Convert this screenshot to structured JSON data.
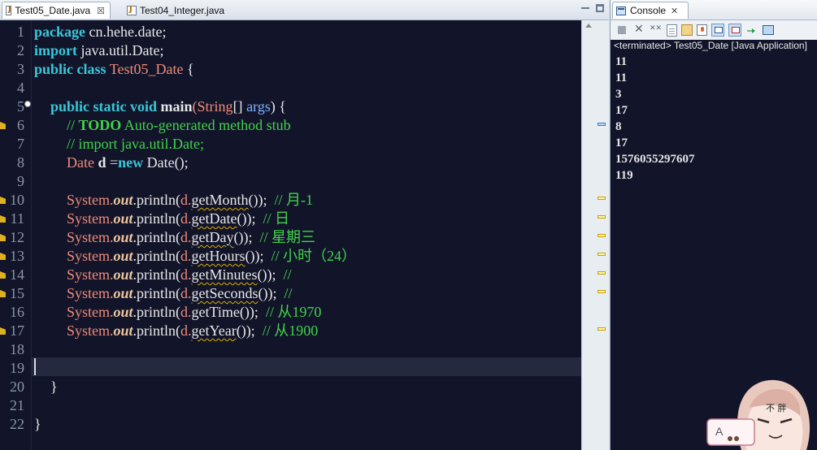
{
  "editor": {
    "tabs": [
      {
        "label": "Test05_Date.java",
        "active": true,
        "close": "☒"
      },
      {
        "label": "Test04_Integer.java",
        "active": false
      }
    ]
  },
  "gutter": {
    "line_numbers": [
      "1",
      "2",
      "3",
      "4",
      "5",
      "6",
      "7",
      "8",
      "9",
      "10",
      "11",
      "12",
      "13",
      "14",
      "15",
      "16",
      "17",
      "18",
      "19",
      "20",
      "21",
      "22"
    ]
  },
  "code": {
    "l1": {
      "kw": "package",
      "rest": " cn.hehe.date;"
    },
    "l2": {
      "kw": "import",
      "rest": " java.util.Date;"
    },
    "l3": {
      "kw": "public class",
      "cls": "Test05_Date",
      "rest": " {"
    },
    "l5": {
      "kw": "public static void",
      "meth": "main",
      "open": "(",
      "type": "String",
      "arr": "[] ",
      "param": "args",
      "rest": ") {"
    },
    "l6": {
      "cm1": "// ",
      "todo": "TODO",
      "cm2": " Auto-generated method stub"
    },
    "l7": {
      "cm": "// import java.util.Date;"
    },
    "l8": {
      "type": "Date",
      "var": "d",
      "eq": " =",
      "kw": "new",
      "rest": " Date();"
    },
    "println_prefix": "System.",
    "println_out": "out",
    "println_call": ".println(",
    "recv": "d.",
    "calls": [
      {
        "method": "getMonth",
        "tail": "());  ",
        "comment": "// 月-1"
      },
      {
        "method": "getDate",
        "tail": "());  ",
        "comment": "// 日"
      },
      {
        "method": "getDay",
        "tail": "());  ",
        "comment": "// 星期三"
      },
      {
        "method": "getHours",
        "tail": "());  ",
        "comment": "// 小时（24）"
      },
      {
        "method": "getMinutes",
        "tail": "());  ",
        "comment": "//"
      },
      {
        "method": "getSeconds",
        "tail": "());  ",
        "comment": "//"
      },
      {
        "method": "getTime",
        "tail": "());  ",
        "comment": "// 从1970"
      },
      {
        "method": "getYear",
        "tail": "());  ",
        "comment": "// 从1900"
      }
    ],
    "l20": "}",
    "l22": "}"
  },
  "console": {
    "tab_label": "Console",
    "status": "<terminated> Test05_Date [Java Application]",
    "output": [
      "11",
      "11",
      "3",
      "17",
      "8",
      "17",
      "1576055297607",
      "119"
    ]
  },
  "mascot": {
    "badge": "A",
    "caption": "不 胖"
  },
  "colors": {
    "keyword": "#3ac6d8",
    "type": "#f08a78",
    "comment": "#42d24a",
    "background": "#12152a"
  }
}
